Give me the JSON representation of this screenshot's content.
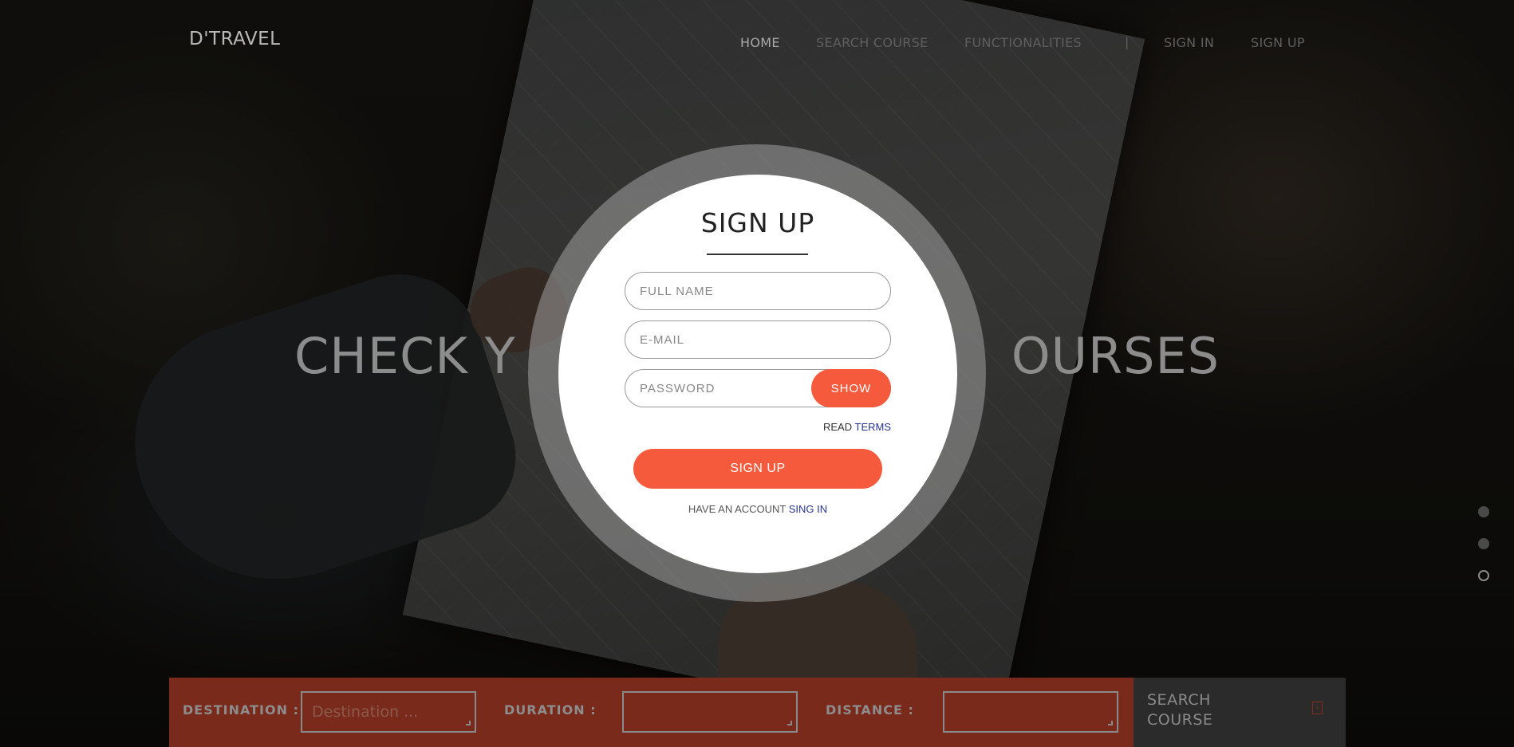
{
  "brand": {
    "logo": "D'TRAVEL"
  },
  "nav": {
    "items": [
      {
        "label": "HOME",
        "active": true
      },
      {
        "label": "SEARCH COURSE",
        "active": false
      },
      {
        "label": "FUNCTIONALITIES",
        "active": false
      },
      {
        "label": "SIGN IN",
        "active": false
      },
      {
        "label": "SIGN UP",
        "active": false
      }
    ],
    "separator": "|"
  },
  "hero": {
    "title": "CHECK Y                              OURSES"
  },
  "signup": {
    "title": "SIGN UP",
    "full_name_placeholder": "FULL NAME",
    "email_placeholder": "E-MAIL",
    "password_placeholder": "PASSWORD",
    "show_label": "SHOW",
    "read_label": "READ",
    "terms_link": "TERMS",
    "submit_label": "SIGN UP",
    "have_account_label": "HAVE AN ACCOUNT",
    "sign_in_link": "SING IN"
  },
  "slider": {
    "dot_count": 3,
    "active_index": 2
  },
  "search": {
    "destination_label": "DESTINATION :",
    "destination_placeholder": "Destination ...",
    "duration_label": "DURATION :",
    "duration_value": "",
    "distance_label": "DISTANCE :",
    "distance_value": "",
    "button_label": "SEARCH COURSE",
    "button_icon": "search-icon"
  },
  "colors": {
    "accent": "#f65a3c",
    "search_bar": "#7a2a1a",
    "link": "#28348c",
    "search_button_bg": "#2b2b2b"
  }
}
